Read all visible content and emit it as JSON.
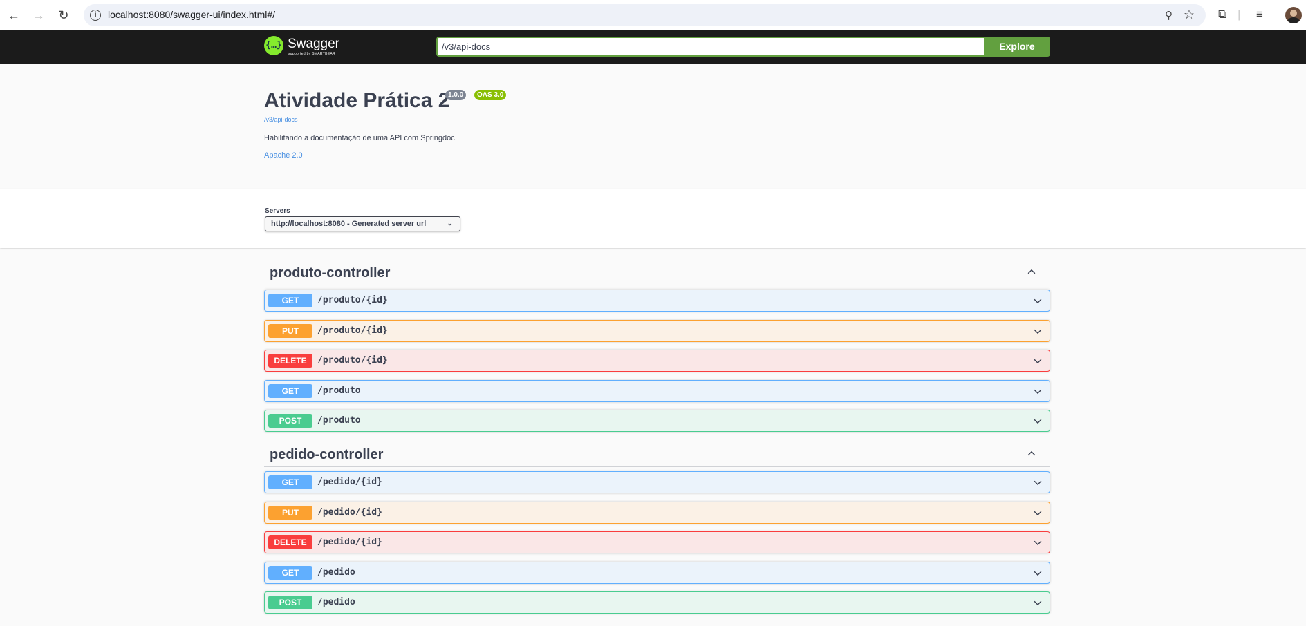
{
  "browser": {
    "url": "localhost:8080/swagger-ui/index.html#/"
  },
  "topbar": {
    "logo_name": "Swagger",
    "logo_sub": "supported by SMARTBEAR",
    "api_url": "/v3/api-docs",
    "explore_label": "Explore"
  },
  "info": {
    "title": "Atividade Prática 2",
    "version": "1.0.0",
    "oas": "OAS 3.0",
    "spec_link": "/v3/api-docs",
    "description": "Habilitando a documentação de uma API com Springdoc",
    "license": "Apache 2.0"
  },
  "servers": {
    "label": "Servers",
    "selected": "http://localhost:8080 - Generated server url"
  },
  "controllers": [
    {
      "name": "produto-controller",
      "operations": [
        {
          "method": "GET",
          "path": "/produto/{id}"
        },
        {
          "method": "PUT",
          "path": "/produto/{id}"
        },
        {
          "method": "DELETE",
          "path": "/produto/{id}"
        },
        {
          "method": "GET",
          "path": "/produto"
        },
        {
          "method": "POST",
          "path": "/produto"
        }
      ]
    },
    {
      "name": "pedido-controller",
      "operations": [
        {
          "method": "GET",
          "path": "/pedido/{id}"
        },
        {
          "method": "PUT",
          "path": "/pedido/{id}"
        },
        {
          "method": "DELETE",
          "path": "/pedido/{id}"
        },
        {
          "method": "GET",
          "path": "/pedido"
        },
        {
          "method": "POST",
          "path": "/pedido"
        }
      ]
    }
  ],
  "colors": {
    "topbar_bg": "#1b1b1b",
    "explore_green": "#62a03f",
    "get": "#61affe",
    "put": "#fca130",
    "delete": "#f93e3e",
    "post": "#49cc90"
  }
}
